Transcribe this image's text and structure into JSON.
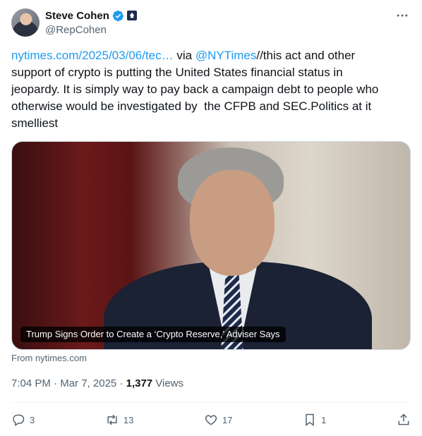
{
  "author": {
    "name": "Steve Cohen",
    "handle": "@RepCohen"
  },
  "tweet": {
    "link_text": "nytimes.com/2025/03/06/tec…",
    "via_text": " via ",
    "mention": "@NYTimes",
    "body": "//this act and other support of crypto is putting the United States financial status in jeopardy. It is simply way to pay back a campaign debt to people who otherwise would be investigated by  the CFPB and SEC.Politics at it smelliest"
  },
  "card": {
    "caption": "Trump Signs Order to Create a ‘Crypto Reserve,’ Adviser Says",
    "source": "From nytimes.com"
  },
  "meta": {
    "time": "7:04 PM",
    "date": "Mar 7, 2025",
    "separator": " · ",
    "views_count": "1,377",
    "views_label": " Views"
  },
  "actions": {
    "replies": "3",
    "reposts": "13",
    "likes": "17",
    "bookmarks": "1"
  },
  "colors": {
    "link": "#1d9bf0",
    "verified": "#1d9bf0",
    "muted": "#536471",
    "text": "#0f1419"
  },
  "icons": [
    "verified-badge-icon",
    "government-badge-icon",
    "more-options-icon",
    "reply-icon",
    "repost-icon",
    "like-icon",
    "bookmark-icon",
    "share-icon"
  ]
}
